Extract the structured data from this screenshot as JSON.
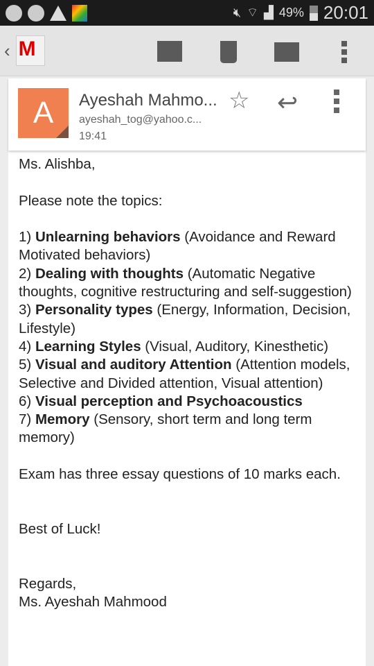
{
  "status_bar": {
    "icons": [
      "messenger-icon",
      "messenger-icon",
      "warning-icon",
      "avg-icon",
      "mute-icon",
      "wifi-icon",
      "signal-icon",
      "battery-icon"
    ],
    "battery": "49%",
    "time": "20:01"
  },
  "app_bar": {
    "icons": [
      "back-icon",
      "gmail-logo",
      "archive-icon",
      "delete-icon",
      "mark-unread-icon",
      "more-icon"
    ]
  },
  "sender": {
    "initial": "A",
    "name": "Ayeshah Mahmo...",
    "email": "ayeshah_tog@yahoo.c...",
    "time": "19:41",
    "avatar_color": "#f08050"
  },
  "body": {
    "greeting": "Ms. Alishba,",
    "intro": "Please note the topics:",
    "topics": [
      {
        "num": "1) ",
        "bold": "Unlearning behaviors",
        "rest": " (Avoidance and Reward Motivated behaviors)"
      },
      {
        "num": "2) ",
        "bold": "Dealing with thoughts",
        "rest": " (Automatic Negative thoughts, cognitive restructuring and self-suggestion)"
      },
      {
        "num": "3) ",
        "bold": "Personality types",
        "rest": " (Energy, Information, Decision, Lifestyle)"
      },
      {
        "num": "4) ",
        "bold": "Learning Styles",
        "rest": " (Visual, Auditory, Kinesthetic)"
      },
      {
        "num": "5) ",
        "bold": "Visual and auditory Attention",
        "rest": " (Attention models, Selective and Divided attention, Visual attention)"
      },
      {
        "num": "6) ",
        "bold": "Visual perception and Psychoacoustics",
        "rest": ""
      },
      {
        "num": "7) ",
        "bold": "Memory",
        "rest": " (Sensory, short term and long term memory)"
      }
    ],
    "exam": "Exam has three essay questions of 10 marks each.",
    "wish": "Best of Luck!",
    "closing": "Regards,",
    "signature": "Ms. Ayeshah Mahmood"
  }
}
